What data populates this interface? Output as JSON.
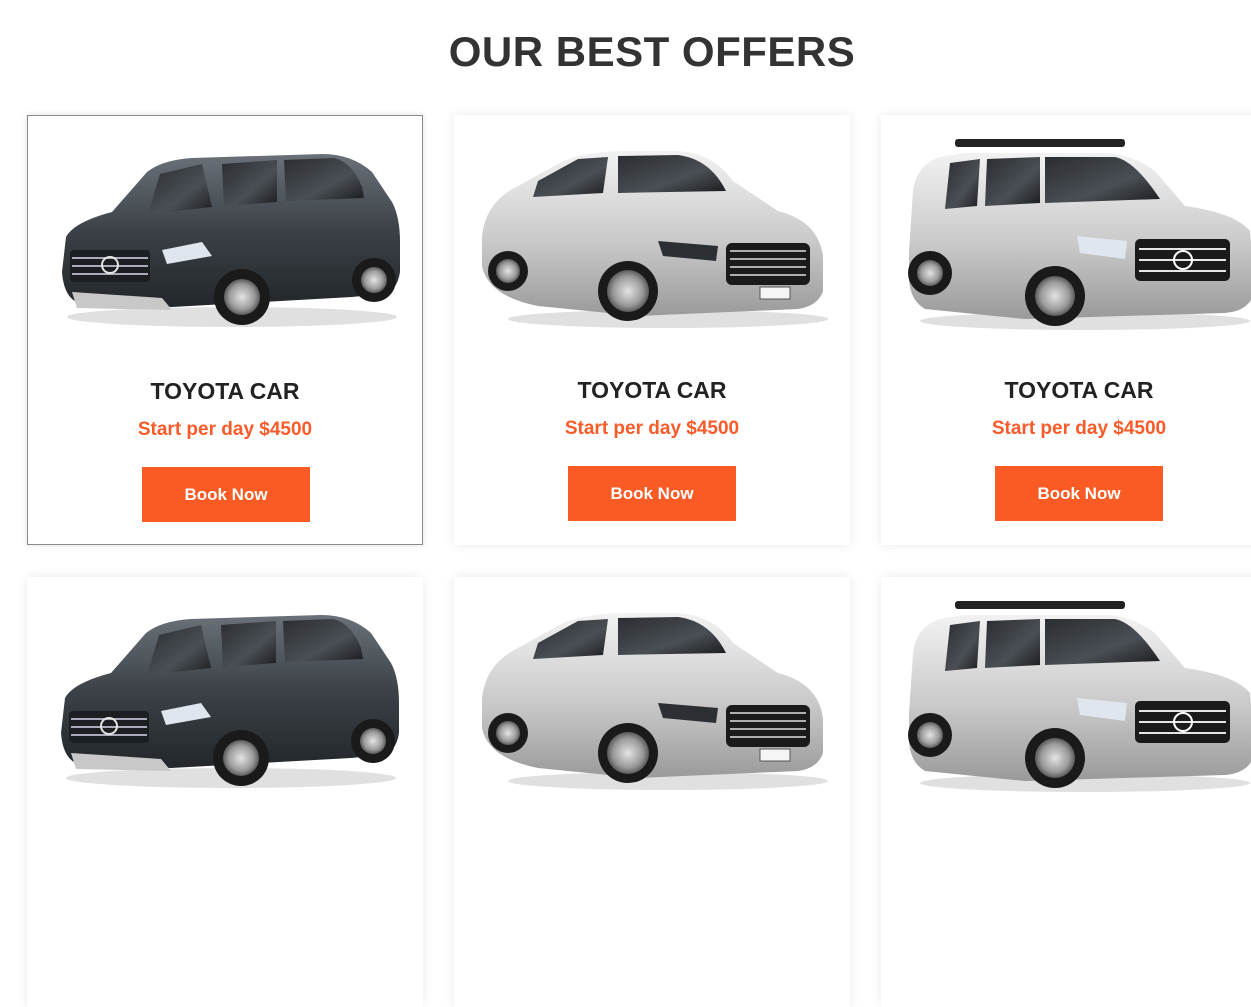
{
  "section": {
    "title": "OUR BEST OFFERS"
  },
  "colors": {
    "accent": "#fa5b24",
    "heading": "#333333"
  },
  "offers": [
    {
      "image": "dark-gray-suv",
      "name": "TOYOTA CAR",
      "price": "Start per day $4500",
      "button": "Book Now"
    },
    {
      "image": "silver-sedan",
      "name": "TOYOTA CAR",
      "price": "Start per day $4500",
      "button": "Book Now"
    },
    {
      "image": "silver-suv",
      "name": "TOYOTA CAR",
      "price": "Start per day $4500",
      "button": "Book Now"
    },
    {
      "image": "dark-gray-suv"
    },
    {
      "image": "silver-sedan"
    },
    {
      "image": "silver-suv"
    }
  ]
}
